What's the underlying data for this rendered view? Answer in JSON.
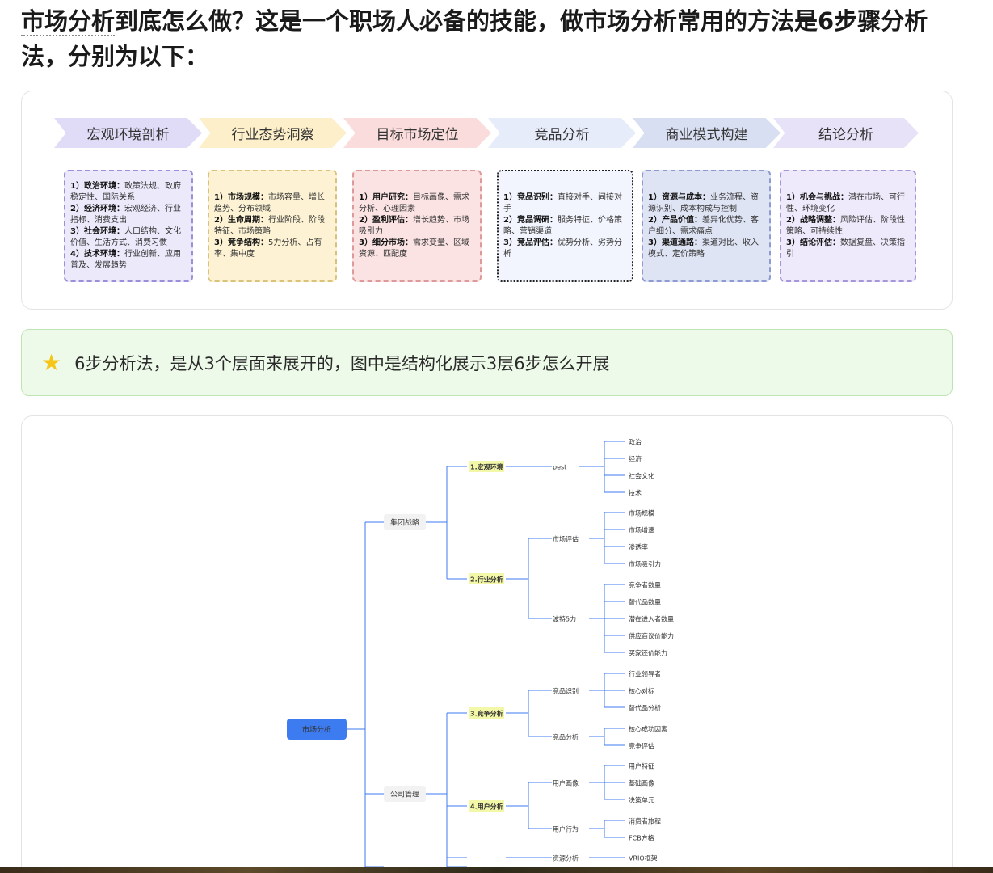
{
  "heading": {
    "part1": "市场分析",
    "part2": "到底怎么做？这是一个职场人必备的技能，做市场分析常用的方法是6步骤分析法，分别为以下："
  },
  "steps": [
    {
      "title": "宏观环境剖析",
      "color": "#e0dcf7",
      "box_bg": "#ece9fb",
      "box_border": "#9a8fd8",
      "items": [
        {
          "label": "1）政治环境：",
          "text": "政策法规、政府稳定性、国际关系"
        },
        {
          "label": "2）经济环境：",
          "text": "宏观经济、行业指标、消费支出"
        },
        {
          "label": "3）社会环境：",
          "text": "人口结构、文化价值、生活方式、消费习惯"
        },
        {
          "label": "4）技术环境：",
          "text": "行业创新、应用普及、发展趋势"
        }
      ]
    },
    {
      "title": "行业态势洞察",
      "color": "#fcefc9",
      "box_bg": "#fdf3d4",
      "box_border": "#d9c27a",
      "items": [
        {
          "label": "1）市场规模：",
          "text": "市场容量、增长趋势、分布领域"
        },
        {
          "label": "2）生命周期：",
          "text": "行业阶段、阶段特征、市场策略"
        },
        {
          "label": "3）竞争结构：",
          "text": "5力分析、占有率、集中度"
        }
      ]
    },
    {
      "title": "目标市场定位",
      "color": "#fbdcdc",
      "box_bg": "#fbe3e3",
      "box_border": "#dd9a9a",
      "items": [
        {
          "label": "1）用户研究：",
          "text": "目标画像、需求分析、心理因素"
        },
        {
          "label": "2）盈利评估：",
          "text": "增长趋势、市场吸引力"
        },
        {
          "label": "3）细分市场：",
          "text": "需求变量、区域资源、匹配度"
        }
      ]
    },
    {
      "title": "竞品分析",
      "color": "#e6ecfa",
      "box_bg": "#f2f5fd",
      "box_border": "#222222",
      "items": [
        {
          "label": "1）竞品识别：",
          "text": "直接对手、间接对手"
        },
        {
          "label": "2）竞品调研：",
          "text": "服务特征、价格策略、营销渠道"
        },
        {
          "label": "3）竞品评估：",
          "text": "优势分析、劣势分析"
        }
      ]
    },
    {
      "title": "商业模式构建",
      "color": "#d8dff2",
      "box_bg": "#dfe4f4",
      "box_border": "#8e9ad0",
      "items": [
        {
          "label": "1）资源与成本：",
          "text": "业务流程、资源识别、成本构成与控制"
        },
        {
          "label": "2）产品价值：",
          "text": "差异化优势、客户细分、需求痛点"
        },
        {
          "label": "3）渠道通路：",
          "text": "渠道对比、收入模式、定价策略"
        }
      ]
    },
    {
      "title": "结论分析",
      "color": "#e8e2f8",
      "box_bg": "#efeafb",
      "box_border": "#a596d8",
      "items": [
        {
          "label": "1）机会与挑战：",
          "text": "潜在市场、可行性、环境变化"
        },
        {
          "label": "2）战略调整：",
          "text": "风险评估、阶段性策略、可持续性"
        },
        {
          "label": "3）结论评估：",
          "text": "数据复盘、决策指引"
        }
      ]
    }
  ],
  "tip": {
    "icon": "star-icon",
    "text": "6步分析法，是从3个层面来展开的，图中是结构化展示3层6步怎么开展"
  },
  "mindmap": {
    "root": "市场分析",
    "accent": "#3d7bf0",
    "highlight": "#f3f7a8",
    "groups": [
      {
        "label": "集团战略",
        "sections": [
          {
            "label": "1.宏观环境",
            "subs": [
              {
                "label": "pest",
                "leaves": [
                  "政治",
                  "经济",
                  "社会文化",
                  "技术"
                ]
              }
            ]
          },
          {
            "label": "2.行业分析",
            "subs": [
              {
                "label": "市场评估",
                "leaves": [
                  "市场规模",
                  "市场增速",
                  "渗透率",
                  "市场吸引力"
                ]
              },
              {
                "label": "波特5力",
                "leaves": [
                  "竞争者数量",
                  "替代品数量",
                  "潜在进入者数量",
                  "供应商议价能力",
                  "买家还价能力"
                ]
              }
            ]
          }
        ]
      },
      {
        "label": "公司管理",
        "sections": [
          {
            "label": "3.竞争分析",
            "subs": [
              {
                "label": "竞品识别",
                "leaves": [
                  "行业领导者",
                  "核心对标",
                  "替代品分析"
                ]
              },
              {
                "label": "竞品分析",
                "leaves": [
                  "核心成功因素",
                  "竞争评估"
                ]
              }
            ]
          },
          {
            "label": "4.用户分析",
            "subs": [
              {
                "label": "用户画像",
                "leaves": [
                  "用户特征",
                  "基础画像",
                  "决策单元"
                ]
              },
              {
                "label": "用户行为",
                "leaves": [
                  "消费者旅程",
                  "FCB方格"
                ]
              }
            ]
          },
          {
            "label": "",
            "subs": [
              {
                "label": "资源分析",
                "leaves": [
                  "VRIO框架"
                ]
              }
            ]
          }
        ]
      }
    ]
  }
}
